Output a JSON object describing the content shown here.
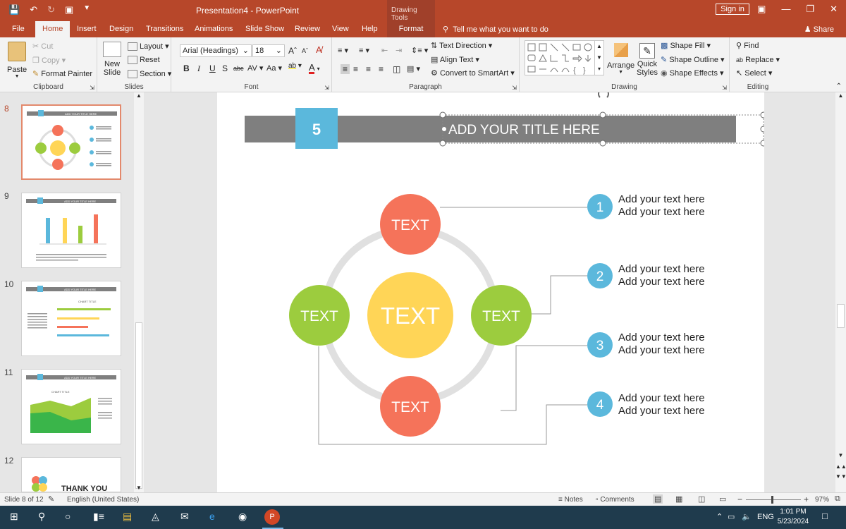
{
  "titlebar": {
    "title": "Presentation4  -  PowerPoint",
    "context_group": "Drawing Tools",
    "signin": "Sign in"
  },
  "tabs": {
    "file": "File",
    "home": "Home",
    "insert": "Insert",
    "design": "Design",
    "transitions": "Transitions",
    "animations": "Animations",
    "slideshow": "Slide Show",
    "review": "Review",
    "view": "View",
    "help": "Help",
    "format": "Format",
    "tellme": "Tell me what you want to do",
    "share": "Share"
  },
  "ribbon": {
    "clipboard": {
      "paste": "Paste",
      "cut": "Cut",
      "copy": "Copy",
      "format_painter": "Format Painter",
      "label": "Clipboard"
    },
    "slides": {
      "new_slide_1": "New",
      "new_slide_2": "Slide",
      "layout": "Layout",
      "reset": "Reset",
      "section": "Section",
      "label": "Slides"
    },
    "font": {
      "name": "Arial (Headings)",
      "size": "18",
      "label": "Font",
      "change_case": "Aa"
    },
    "paragraph": {
      "text_direction": "Text Direction",
      "align_text": "Align Text",
      "convert_smartart": "Convert to SmartArt",
      "label": "Paragraph"
    },
    "drawing": {
      "arrange": "Arrange",
      "quick_styles_1": "Quick",
      "quick_styles_2": "Styles",
      "shape_fill": "Shape Fill",
      "shape_outline": "Shape Outline",
      "shape_effects": "Shape Effects",
      "label": "Drawing"
    },
    "editing": {
      "find": "Find",
      "replace": "Replace",
      "select": "Select",
      "label": "Editing"
    }
  },
  "thumbnails": [
    {
      "num": "8",
      "title": "ADD YOUR TITLE HERE"
    },
    {
      "num": "9",
      "title": "ADD YOUR TITLE HERE"
    },
    {
      "num": "10",
      "title": "ADD YOUR TITLE HERE",
      "chart": "CHART TITLE"
    },
    {
      "num": "11",
      "title": "ADD YOUR TITLE HERE",
      "chart": "CHART TITLE"
    },
    {
      "num": "12",
      "title": "THANK YOU"
    }
  ],
  "slide": {
    "number": "5",
    "title": "ADD YOUR TITLE HERE",
    "center_label": "TEXT",
    "circle_labels": {
      "top": "TEXT",
      "left": "TEXT",
      "right": "TEXT",
      "bottom": "TEXT"
    },
    "items": [
      {
        "num": "1",
        "line1": "Add your text here",
        "line2": "Add your text here"
      },
      {
        "num": "2",
        "line1": "Add your text here",
        "line2": "Add your text here"
      },
      {
        "num": "3",
        "line1": "Add your text here",
        "line2": "Add your text here"
      },
      {
        "num": "4",
        "line1": "Add your text here",
        "line2": "Add your text here"
      }
    ]
  },
  "status": {
    "slide": "Slide 8 of 12",
    "language": "English (United States)",
    "notes": "Notes",
    "comments": "Comments",
    "zoom": "97%"
  },
  "taskbar": {
    "lang": "ENG",
    "time": "1:01 PM",
    "date": "5/23/2024"
  },
  "colors": {
    "accent": "#b7472a",
    "orange": "#f5735a",
    "green": "#9ccc3e",
    "yellow": "#ffd557",
    "blue": "#5bb8dc",
    "gray_bar": "#7f7f7f"
  }
}
